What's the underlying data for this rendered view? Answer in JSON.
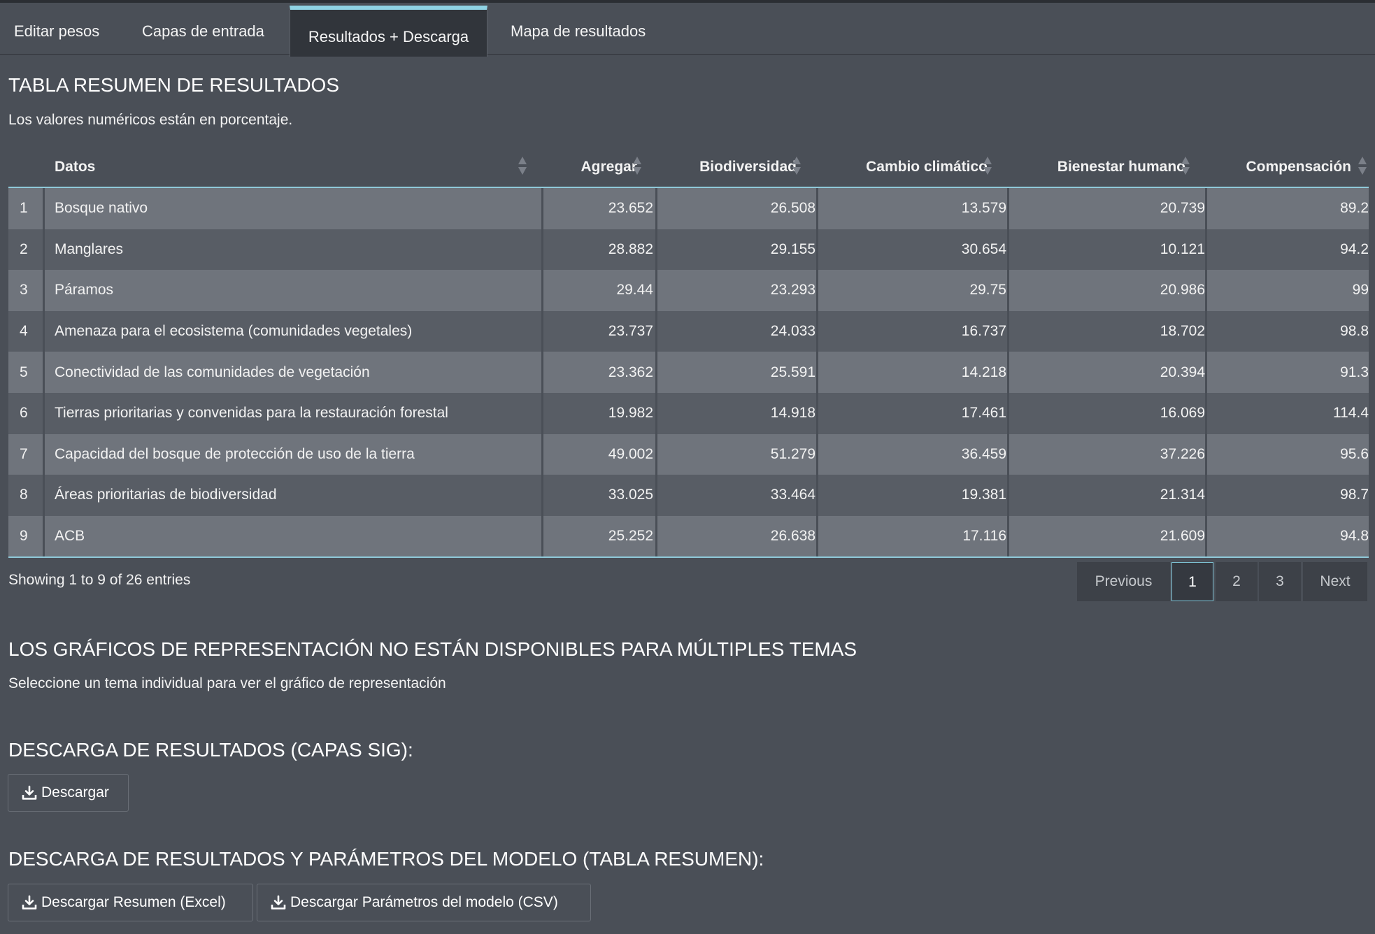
{
  "tabs": [
    {
      "label": "Editar pesos",
      "active": false
    },
    {
      "label": "Capas de entrada",
      "active": false
    },
    {
      "label": "Resultados + Descarga",
      "active": true
    },
    {
      "label": "Mapa de resultados",
      "active": false
    }
  ],
  "summary": {
    "title": "TABLA RESUMEN DE RESULTADOS",
    "subtitle": "Los valores numéricos están en porcentaje."
  },
  "table": {
    "columns": [
      "Datos",
      "Agregar",
      "Biodiversidad",
      "Cambio climático",
      "Bienestar humano",
      "Compensación"
    ],
    "rows": [
      {
        "index": "1",
        "name": "Bosque nativo",
        "values": [
          "23.652",
          "26.508",
          "13.579",
          "20.739",
          "89.2"
        ]
      },
      {
        "index": "2",
        "name": "Manglares",
        "values": [
          "28.882",
          "29.155",
          "30.654",
          "10.121",
          "94.2"
        ]
      },
      {
        "index": "3",
        "name": "Páramos",
        "values": [
          "29.44",
          "23.293",
          "29.75",
          "20.986",
          "99"
        ]
      },
      {
        "index": "4",
        "name": "Amenaza para el ecosistema (comunidades vegetales)",
        "values": [
          "23.737",
          "24.033",
          "16.737",
          "18.702",
          "98.8"
        ]
      },
      {
        "index": "5",
        "name": "Conectividad de las comunidades de vegetación",
        "values": [
          "23.362",
          "25.591",
          "14.218",
          "20.394",
          "91.3"
        ]
      },
      {
        "index": "6",
        "name": "Tierras prioritarias y convenidas para la restauración forestal",
        "values": [
          "19.982",
          "14.918",
          "17.461",
          "16.069",
          "114.4"
        ]
      },
      {
        "index": "7",
        "name": "Capacidad del bosque de protección de uso de la tierra",
        "values": [
          "49.002",
          "51.279",
          "36.459",
          "37.226",
          "95.6"
        ]
      },
      {
        "index": "8",
        "name": "Áreas prioritarias de biodiversidad",
        "values": [
          "33.025",
          "33.464",
          "19.381",
          "21.314",
          "98.7"
        ]
      },
      {
        "index": "9",
        "name": "ACB",
        "values": [
          "25.252",
          "26.638",
          "17.116",
          "21.609",
          "94.8"
        ]
      }
    ],
    "info": "Showing 1 to 9 of 26 entries",
    "pagination": {
      "previous": "Previous",
      "pages": [
        "1",
        "2",
        "3"
      ],
      "current_page": "1",
      "next": "Next"
    }
  },
  "charts_notice": {
    "title": "LOS GRÁFICOS DE REPRESENTACIÓN NO ESTÁN DISPONIBLES PARA MÚLTIPLES TEMAS",
    "subtitle": "Seleccione un tema individual para ver el gráfico de representación"
  },
  "gis_download": {
    "title": "DESCARGA DE RESULTADOS (CAPAS SIG):",
    "button_label": "Descargar",
    "icon": "download-icon"
  },
  "summary_download": {
    "title": "DESCARGA DE RESULTADOS Y PARÁMETROS DEL MODELO (TABLA RESUMEN):",
    "excel_button_label": "Descargar Resumen (Excel)",
    "csv_button_label": "Descargar Parámetros del modelo (CSV)",
    "icon": "download-icon"
  },
  "colors": {
    "background": "#4a4f57",
    "active_tab_accent": "#8fd3e4",
    "row_odd": "#6f747c",
    "row_even": "#585d65"
  }
}
